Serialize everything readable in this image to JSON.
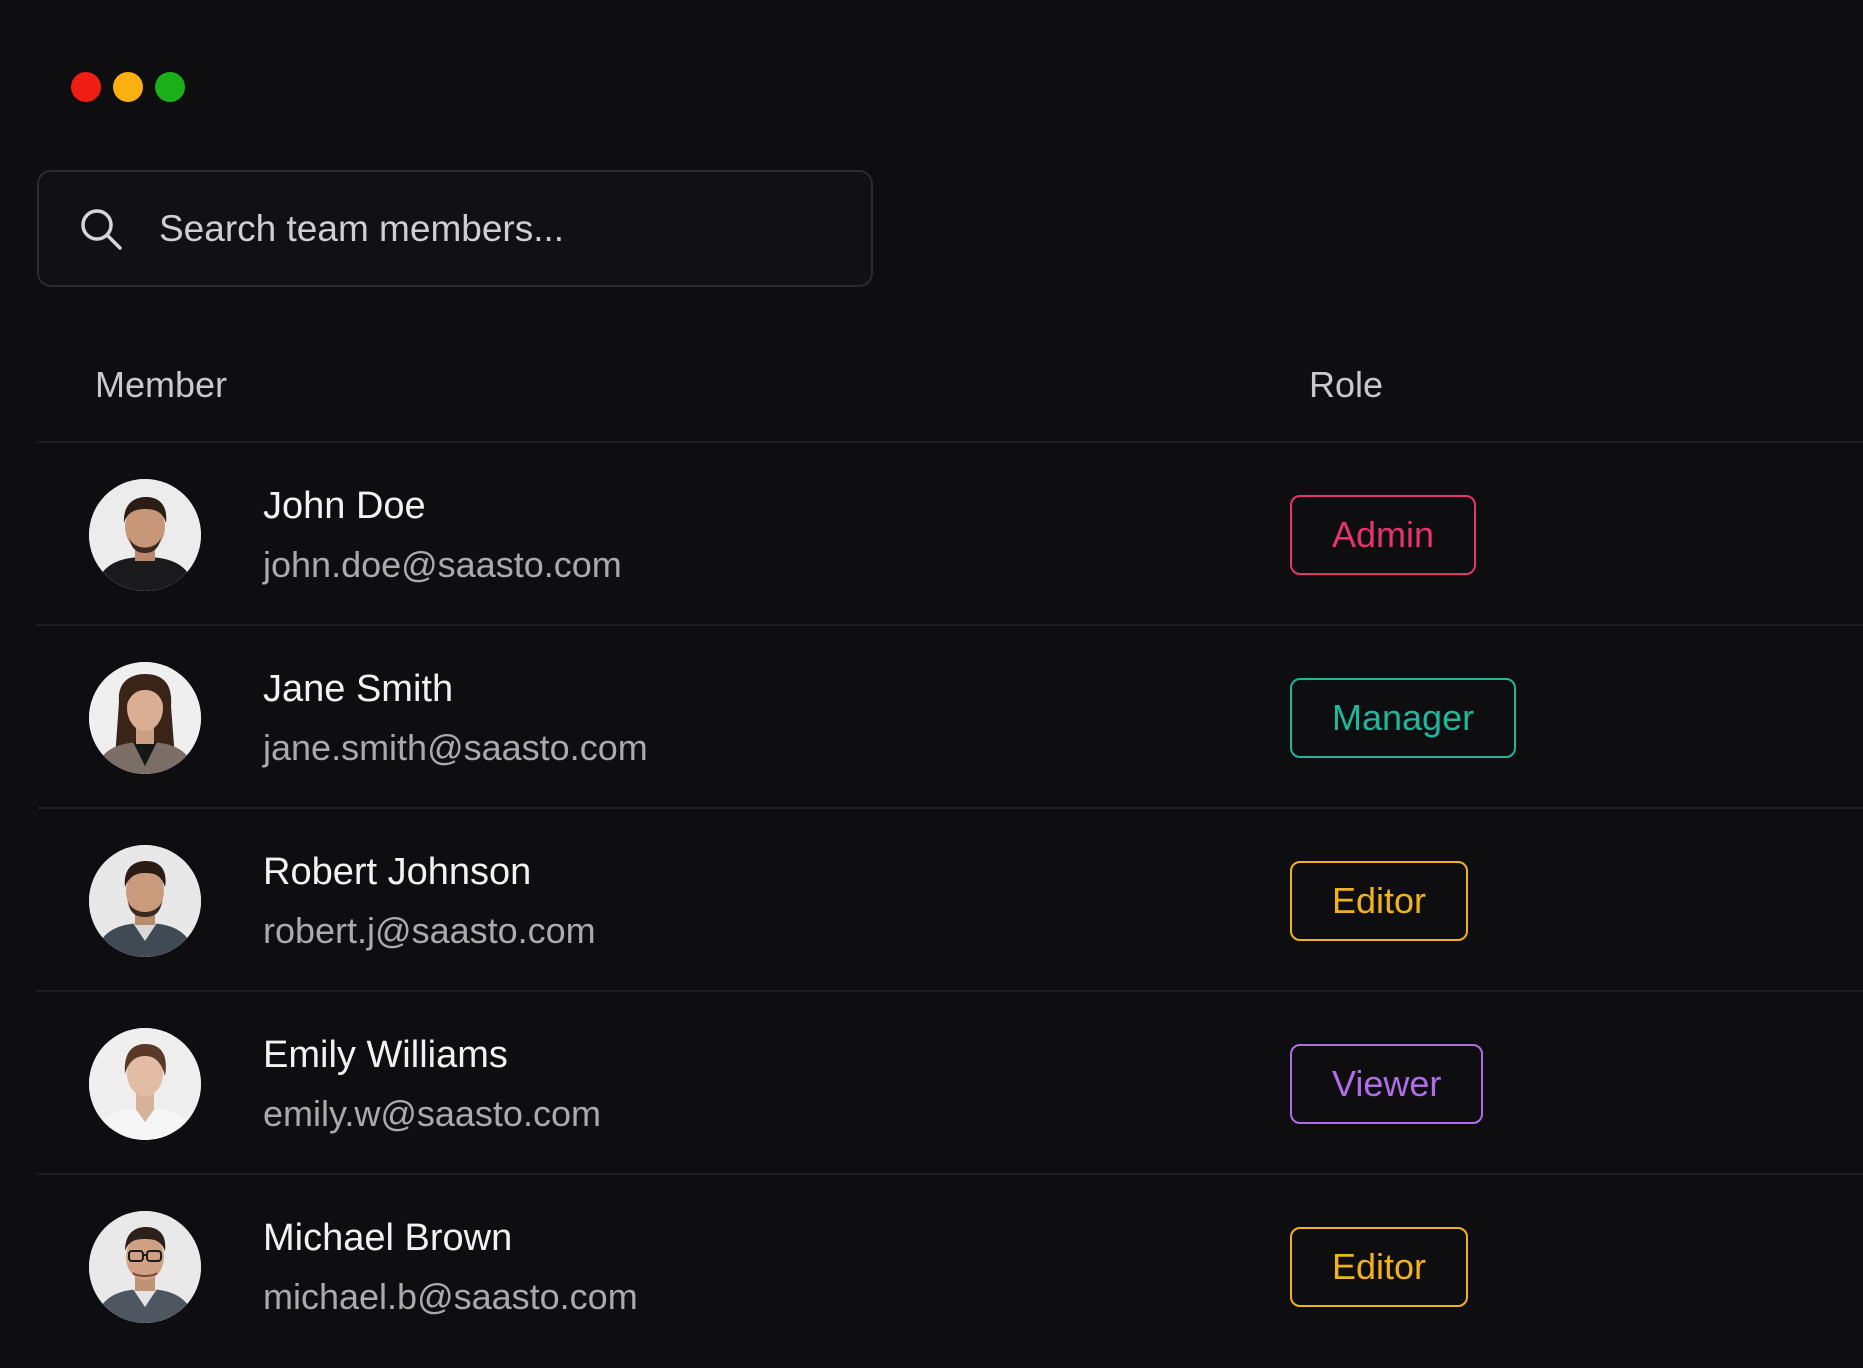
{
  "search": {
    "placeholder": "Search team members..."
  },
  "table": {
    "headers": {
      "member": "Member",
      "role": "Role"
    },
    "rows": [
      {
        "name": "John Doe",
        "email": "john.doe@saasto.com",
        "role": "Admin",
        "role_color": "#e8336d"
      },
      {
        "name": "Jane Smith",
        "email": "jane.smith@saasto.com",
        "role": "Manager",
        "role_color": "#1fb69b"
      },
      {
        "name": "Robert Johnson",
        "email": "robert.j@saasto.com",
        "role": "Editor",
        "role_color": "#f0b21e"
      },
      {
        "name": "Emily Williams",
        "email": "emily.w@saasto.com",
        "role": "Viewer",
        "role_color": "#b06ee6"
      },
      {
        "name": "Michael Brown",
        "email": "michael.b@saasto.com",
        "role": "Editor",
        "role_color": "#f0b21e"
      }
    ]
  },
  "colors": {
    "background": "#0e0e10",
    "traffic_close": "#f01e12",
    "traffic_minimize": "#fcb00f",
    "traffic_zoom": "#1bb017"
  }
}
